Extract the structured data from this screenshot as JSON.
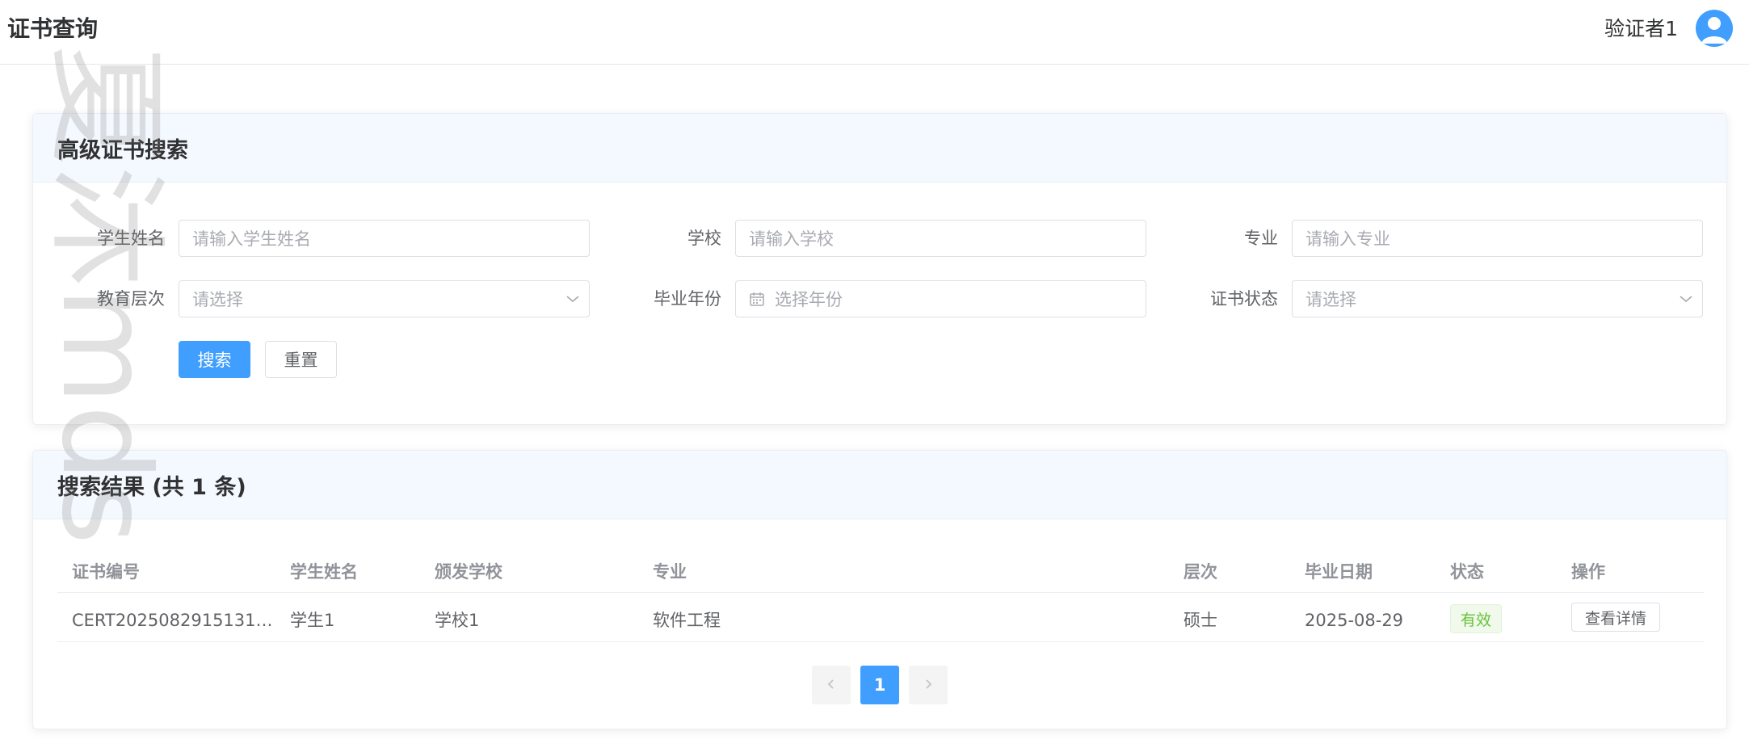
{
  "header": {
    "title": "证书查询",
    "user_name": "验证者1"
  },
  "search": {
    "title": "高级证书搜索",
    "fields": {
      "student_name": {
        "label": "学生姓名",
        "placeholder": "请输入学生姓名"
      },
      "school": {
        "label": "学校",
        "placeholder": "请输入学校"
      },
      "major": {
        "label": "专业",
        "placeholder": "请输入专业"
      },
      "education_level": {
        "label": "教育层次",
        "placeholder": "请选择"
      },
      "graduation_year": {
        "label": "毕业年份",
        "placeholder": "选择年份"
      },
      "certificate_status": {
        "label": "证书状态",
        "placeholder": "请选择"
      }
    },
    "search_button": "搜索",
    "reset_button": "重置"
  },
  "results": {
    "title": "搜索结果 (共 1 条)",
    "columns": [
      "证书编号",
      "学生姓名",
      "颁发学校",
      "专业",
      "层次",
      "毕业日期",
      "状态",
      "操作"
    ],
    "rows": [
      {
        "cert_no": "CERT2025082915131…",
        "student_name": "学生1",
        "school": "学校1",
        "major": "软件工程",
        "level": "硕士",
        "grad_date": "2025-08-29",
        "status": "有效",
        "action": "查看详情"
      }
    ],
    "pagination": {
      "prev_icon": "chevron-left-icon",
      "current_page": "1",
      "next_icon": "chevron-right-icon"
    }
  },
  "watermark": "夏沐mds",
  "colors": {
    "primary": "#409eff",
    "status_valid": "#67c23a",
    "card_header_bg": "#f4f9ff"
  }
}
